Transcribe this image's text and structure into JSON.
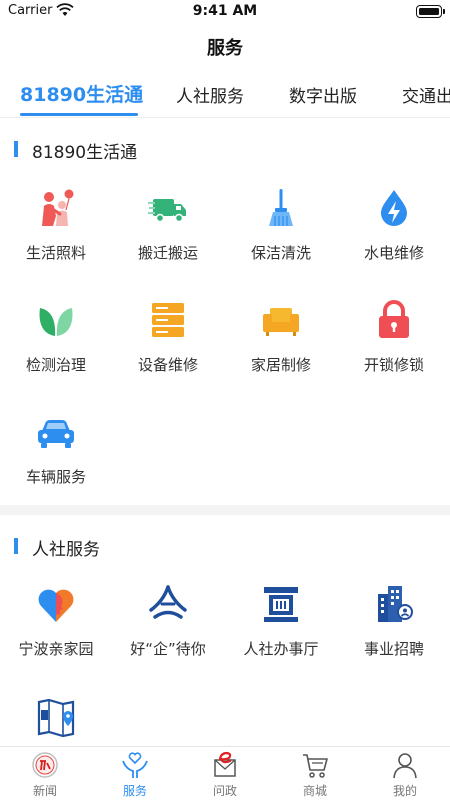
{
  "status_bar": {
    "carrier": "Carrier",
    "time": "9:41 AM"
  },
  "header": {
    "title": "服务"
  },
  "tabs": [
    {
      "label": "81890生活通",
      "active": true
    },
    {
      "label": "人社服务",
      "active": false
    },
    {
      "label": "数字出版",
      "active": false
    },
    {
      "label": "交通出",
      "active": false
    }
  ],
  "sections": [
    {
      "title": "81890生活通",
      "items": [
        {
          "label": "生活照料",
          "icon": "family-care-icon"
        },
        {
          "label": "搬迁搬运",
          "icon": "moving-truck-icon"
        },
        {
          "label": "保洁清洗",
          "icon": "broom-icon"
        },
        {
          "label": "水电维修",
          "icon": "water-electric-icon"
        },
        {
          "label": "检测治理",
          "icon": "leaf-icon"
        },
        {
          "label": "设备维修",
          "icon": "server-icon"
        },
        {
          "label": "家居制修",
          "icon": "sofa-icon"
        },
        {
          "label": "开锁修锁",
          "icon": "lock-icon"
        },
        {
          "label": "车辆服务",
          "icon": "car-icon"
        }
      ]
    },
    {
      "title": "人社服务",
      "items": [
        {
          "label": "宁波亲家园",
          "icon": "heart-face-icon"
        },
        {
          "label": "好“企”待你",
          "icon": "enterprise-logo-icon"
        },
        {
          "label": "人社办事厅",
          "icon": "government-hall-icon"
        },
        {
          "label": "事业招聘",
          "icon": "office-building-icon"
        },
        {
          "label": "",
          "icon": "startup-map-icon"
        }
      ]
    }
  ],
  "bottom_nav": [
    {
      "label": "新闻",
      "icon": "news-badge-icon",
      "active": false
    },
    {
      "label": "服务",
      "icon": "service-heart-icon",
      "active": true
    },
    {
      "label": "问政",
      "icon": "inquiry-e-icon",
      "active": false
    },
    {
      "label": "商城",
      "icon": "cart-icon",
      "active": false
    },
    {
      "label": "我的",
      "icon": "user-icon",
      "active": false
    }
  ],
  "colors": {
    "accent": "#2d8ef0",
    "red": "#ef5a56",
    "green": "#33b27a",
    "orange": "#f5a623",
    "navy": "#1f4f9c"
  }
}
